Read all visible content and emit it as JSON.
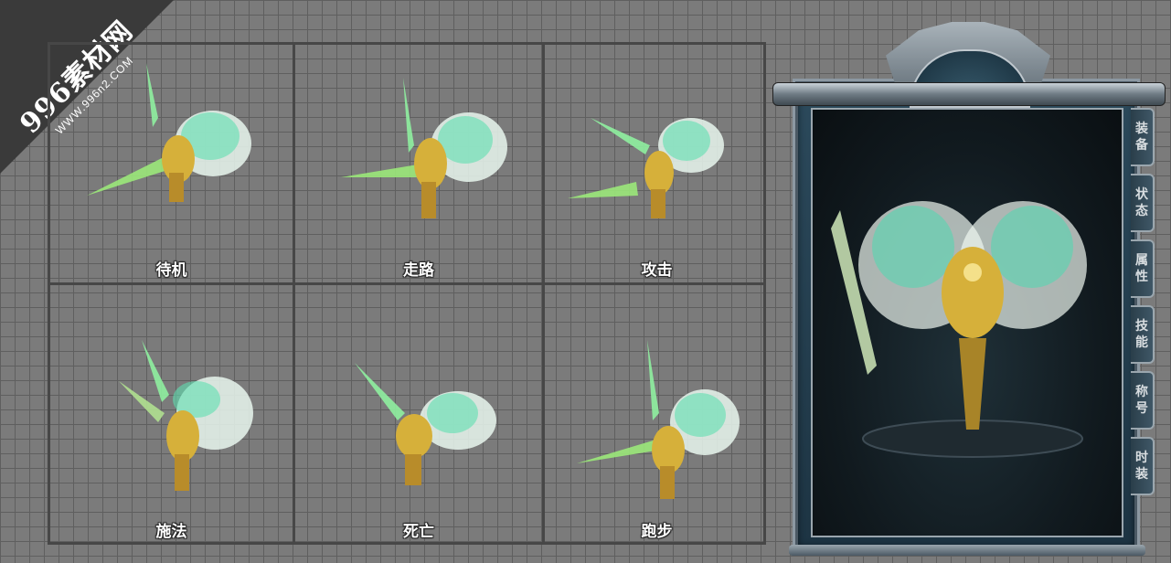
{
  "watermark": {
    "main": "996素材网",
    "sub": "WWW.996n2.COM"
  },
  "actions": [
    {
      "label": "待机"
    },
    {
      "label": "走路"
    },
    {
      "label": "攻击"
    },
    {
      "label": "施法"
    },
    {
      "label": "死亡"
    },
    {
      "label": "跑步"
    }
  ],
  "panel": {
    "tabs": [
      {
        "chars": [
          "装",
          "备"
        ]
      },
      {
        "chars": [
          "状",
          "态"
        ]
      },
      {
        "chars": [
          "属",
          "性"
        ]
      },
      {
        "chars": [
          "技",
          "能"
        ]
      },
      {
        "chars": [
          "称",
          "号"
        ]
      },
      {
        "chars": [
          "时",
          "装"
        ]
      }
    ]
  },
  "colors": {
    "background": "#7b7b7b",
    "grid_line": "#5f5f5f",
    "cell_border": "#474747",
    "wing_green": "#7fe8b8",
    "gold": "#e8c64a",
    "panel_blue": "#1d3443"
  },
  "icons": [
    "wing-sprite-icon",
    "character-portrait-icon",
    "crest-ornament-icon"
  ]
}
